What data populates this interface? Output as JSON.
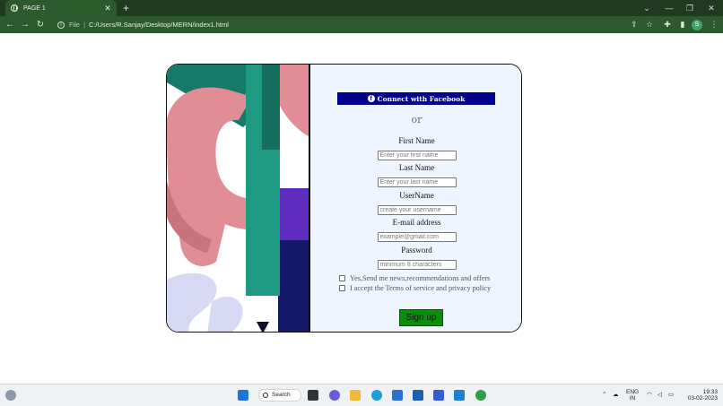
{
  "browser": {
    "tab_title": "PAGE 1",
    "tab_close": "✕",
    "new_tab": "+",
    "window_controls": [
      "⌄",
      "—",
      "❐",
      "✕"
    ],
    "file_label": "File",
    "separator": "|",
    "url": "C:/Users/R.Sanjay/Desktop/MERN/index1.html",
    "profile_initial": "S"
  },
  "signup": {
    "facebook_button": "Connect with Facebook",
    "facebook_glyph": "f",
    "or_text": "or",
    "fields": [
      {
        "label": "First Name",
        "placeholder": "Enter your first name"
      },
      {
        "label": "Last Name",
        "placeholder": "Enter your last name"
      },
      {
        "label": "UserName",
        "placeholder": "create your username"
      },
      {
        "label": "E-mail address",
        "placeholder": "example@gmail.com"
      },
      {
        "label": "Password",
        "placeholder": "minimum 8 characters"
      }
    ],
    "checkboxes": [
      "Yes,Send me news,recommendations and offers",
      "I accept the Terms of service and privacy policy"
    ],
    "submit": "Sign up"
  },
  "taskbar": {
    "search_label": "Search",
    "lang_top": "ENG",
    "lang_bottom": "IN",
    "time": "19:33",
    "date": "03-02-2023"
  },
  "colors": {
    "tab_strip": "#1f3a1f",
    "address_bar": "#2c5a2c",
    "form_bg": "#eef5ff",
    "facebook_blue": "#00008b",
    "signup_green": "#0b8f0b"
  }
}
